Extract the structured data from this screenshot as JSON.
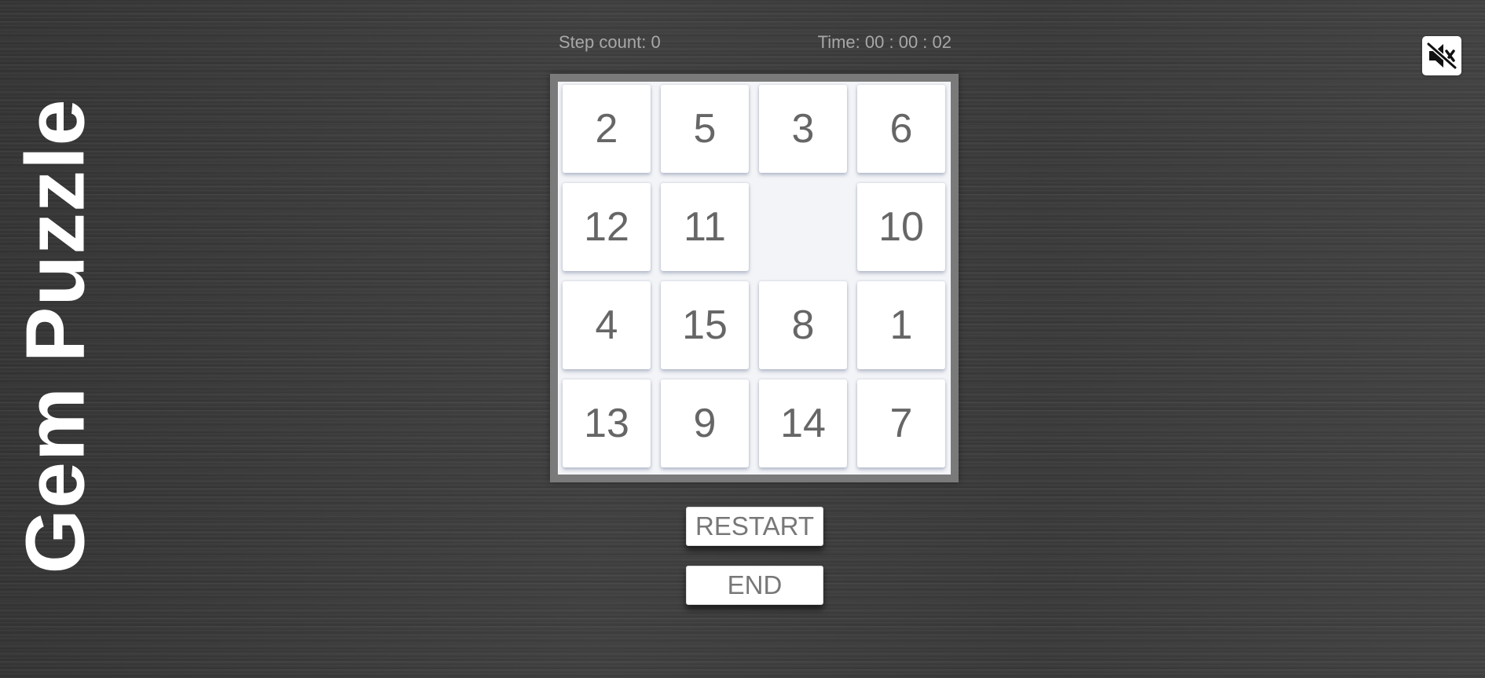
{
  "title": "Gem Puzzle",
  "stats": {
    "step_label": "Step count:",
    "step_count": "0",
    "time_label": "Time:",
    "time_value": "00 : 00 : 02"
  },
  "board": {
    "size": 4,
    "tiles": [
      [
        "2",
        "5",
        "3",
        "6"
      ],
      [
        "12",
        "11",
        "",
        "10"
      ],
      [
        "4",
        "15",
        "8",
        "1"
      ],
      [
        "13",
        "9",
        "14",
        "7"
      ]
    ]
  },
  "buttons": {
    "restart": "RESTART",
    "end": "END"
  },
  "sound": {
    "icon": "speaker-muted-icon",
    "muted": true
  },
  "colors": {
    "title": "#ffffff",
    "tile_text": "#666666",
    "stats_text": "#a8a8a8",
    "board_frame": "#7a7a7a",
    "button_text": "#777777"
  }
}
